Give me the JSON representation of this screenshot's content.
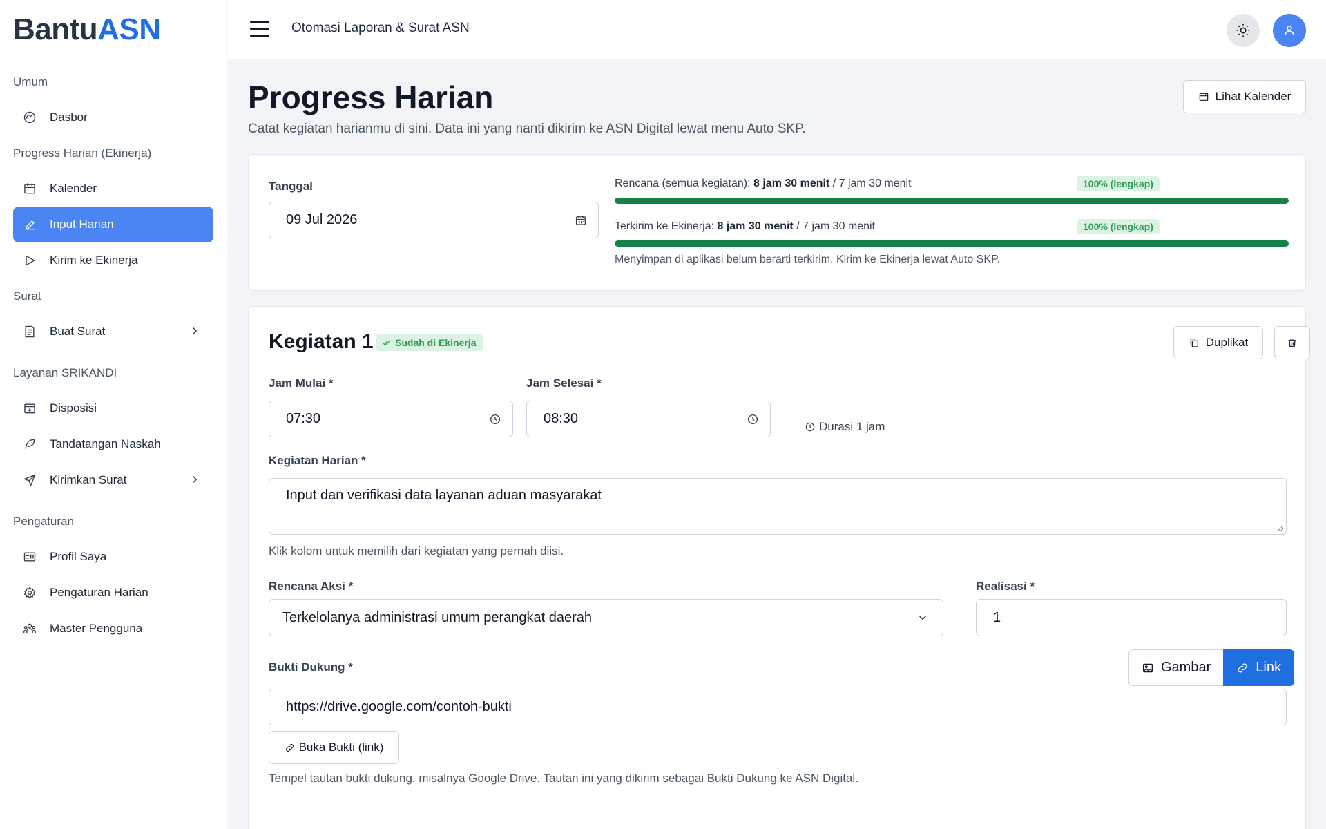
{
  "brand": {
    "part1": "Bantu",
    "part2": "ASN"
  },
  "topbar": {
    "title": "Otomasi Laporan & Surat ASN"
  },
  "sidebar": {
    "sections": [
      {
        "label": "Umum",
        "items": [
          {
            "label": "Dasbor",
            "icon": "gauge-icon"
          }
        ]
      },
      {
        "label": "Progress Harian (Ekinerja)",
        "items": [
          {
            "label": "Kalender",
            "icon": "calendar-icon"
          },
          {
            "label": "Input Harian",
            "icon": "pencil-icon",
            "active": true
          },
          {
            "label": "Kirim ke Ekinerja",
            "icon": "play-icon"
          }
        ]
      },
      {
        "label": "Surat",
        "items": [
          {
            "label": "Buat Surat",
            "icon": "document-icon",
            "chevron": true
          }
        ]
      },
      {
        "label": "Layanan SRIKANDI",
        "items": [
          {
            "label": "Disposisi",
            "icon": "calendar-arrow-icon"
          },
          {
            "label": "Tandatangan Naskah",
            "icon": "feather-icon"
          },
          {
            "label": "Kirimkan Surat",
            "icon": "send-icon",
            "chevron": true
          }
        ]
      },
      {
        "label": "Pengaturan",
        "items": [
          {
            "label": "Profil Saya",
            "icon": "id-card-icon"
          },
          {
            "label": "Pengaturan Harian",
            "icon": "gear-icon"
          },
          {
            "label": "Master Pengguna",
            "icon": "users-icon"
          }
        ]
      }
    ]
  },
  "page": {
    "title": "Progress Harian",
    "subtitle": "Catat kegiatan harianmu di sini. Data ini yang nanti dikirim ke ASN Digital lewat menu Auto SKP.",
    "calendar_button": "Lihat Kalender"
  },
  "summary": {
    "date_label": "Tanggal",
    "date_value": "09 Jul 2026",
    "plan": {
      "prefix": "Rencana (semua kegiatan): ",
      "done": "8 jam 30 menit",
      "suffix": " / 7 jam 30 menit",
      "badge": "100% (lengkap)",
      "progress": 100
    },
    "sent": {
      "prefix": "Terkirim ke Ekinerja: ",
      "done": "8 jam 30 menit",
      "suffix": " / 7 jam 30 menit",
      "badge": "100% (lengkap)",
      "progress": 100
    },
    "note": "Menyimpan di aplikasi belum berarti terkirim. Kirim ke Ekinerja lewat Auto SKP."
  },
  "activity": {
    "title": "Kegiatan 1",
    "status": "Sudah di Ekinerja",
    "duplicate_button": "Duplikat",
    "start_label": "Jam Mulai *",
    "start_value": "07:30",
    "end_label": "Jam Selesai *",
    "end_value": "08:30",
    "duration": "Durasi 1 jam",
    "activity_label": "Kegiatan Harian *",
    "activity_value": "Input dan verifikasi data layanan aduan masyarakat",
    "activity_help": "Klik kolom untuk memilih dari kegiatan yang pernah diisi.",
    "plan_label": "Rencana Aksi *",
    "plan_value": "Terkelolanya administrasi umum perangkat daerah",
    "realization_label": "Realisasi *",
    "realization_value": "1",
    "evidence_label": "Bukti Dukung *",
    "toggle_image": "Gambar",
    "toggle_link": "Link",
    "evidence_value": "https://drive.google.com/contoh-bukti",
    "open_button": "Buka Bukti (link)",
    "evidence_help": "Tempel tautan bukti dukung, misalnya Google Drive. Tautan ini yang dikirim sebagai Bukti Dukung ke ASN Digital."
  },
  "colors": {
    "accent": "#1f6fe0",
    "active_nav": "#4a85f3",
    "progress": "#16824a",
    "success_bg": "#dcf3e3",
    "success_text": "#2f9b57"
  }
}
